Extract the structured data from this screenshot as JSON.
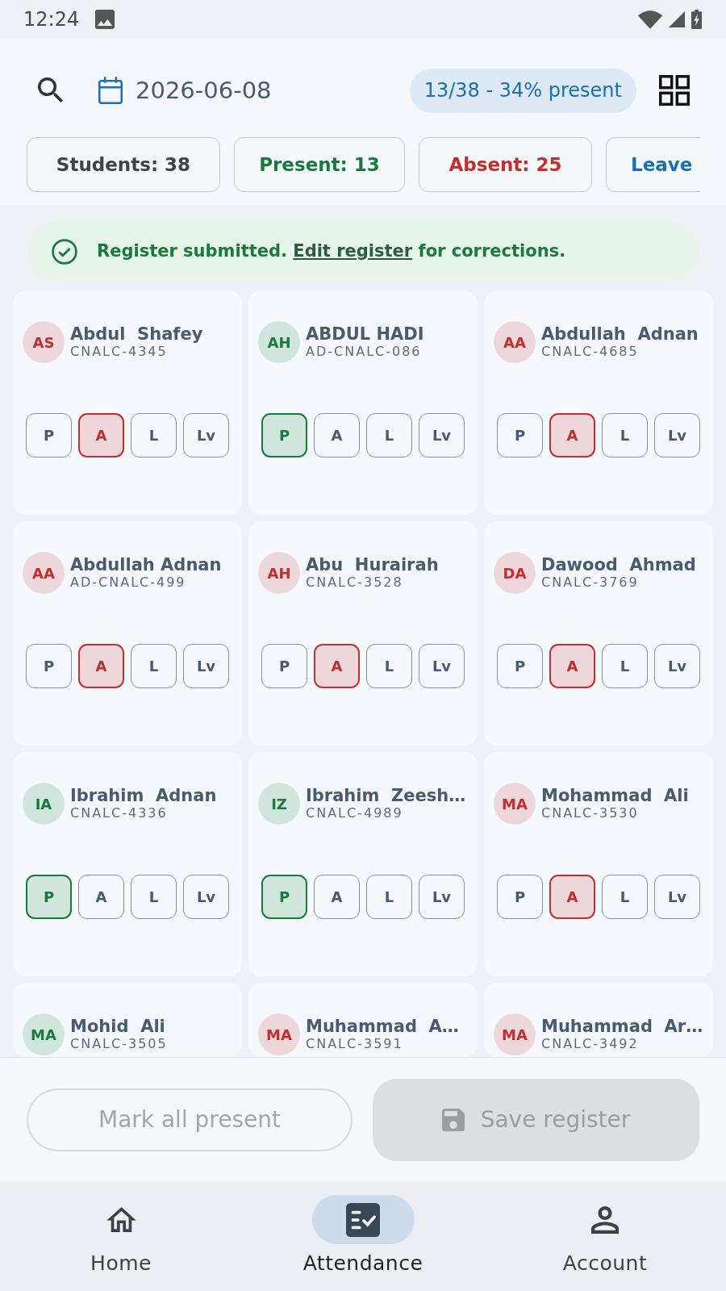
{
  "status_bar": {
    "time": "12:24"
  },
  "header": {
    "date": "2026-06-08",
    "summary": "13/38 - 34% present"
  },
  "stat_chips": [
    {
      "label": "Students: 38",
      "color": "#3f444c"
    },
    {
      "label": "Present: 13",
      "color": "#1a7a3e"
    },
    {
      "label": "Absent: 25",
      "color": "#c0302f"
    },
    {
      "label": "Leave",
      "color": "#1a6fb5"
    }
  ],
  "banner": {
    "text_before": "Register submitted.",
    "link": "Edit register",
    "text_after": "for corrections."
  },
  "students": [
    {
      "initials": "AS",
      "name": "Abdul  Shafey",
      "id": "CNALC-4345",
      "present": false,
      "marks": [
        {
          "label": "P",
          "selected": false
        },
        {
          "label": "A",
          "selected": true
        },
        {
          "label": "L",
          "selected": false
        },
        {
          "label": "Lv",
          "selected": false
        }
      ]
    },
    {
      "initials": "AH",
      "name": "ABDUL HADI",
      "id": "AD-CNALC-086",
      "present": true,
      "marks": [
        {
          "label": "P",
          "selected": true
        },
        {
          "label": "A",
          "selected": false
        },
        {
          "label": "L",
          "selected": false
        },
        {
          "label": "Lv",
          "selected": false
        }
      ]
    },
    {
      "initials": "AA",
      "name": "Abdullah  Adnan",
      "id": "CNALC-4685",
      "present": false,
      "marks": [
        {
          "label": "P",
          "selected": false
        },
        {
          "label": "A",
          "selected": true
        },
        {
          "label": "L",
          "selected": false
        },
        {
          "label": "Lv",
          "selected": false
        }
      ]
    },
    {
      "initials": "AA",
      "name": "Abdullah Adnan",
      "id": "AD-CNALC-499",
      "present": false,
      "marks": [
        {
          "label": "P",
          "selected": false
        },
        {
          "label": "A",
          "selected": true
        },
        {
          "label": "L",
          "selected": false
        },
        {
          "label": "Lv",
          "selected": false
        }
      ]
    },
    {
      "initials": "AH",
      "name": "Abu  Hurairah",
      "id": "CNALC-3528",
      "present": false,
      "marks": [
        {
          "label": "P",
          "selected": false
        },
        {
          "label": "A",
          "selected": true
        },
        {
          "label": "L",
          "selected": false
        },
        {
          "label": "Lv",
          "selected": false
        }
      ]
    },
    {
      "initials": "DA",
      "name": "Dawood  Ahmad",
      "id": "CNALC-3769",
      "present": false,
      "marks": [
        {
          "label": "P",
          "selected": false
        },
        {
          "label": "A",
          "selected": true
        },
        {
          "label": "L",
          "selected": false
        },
        {
          "label": "Lv",
          "selected": false
        }
      ]
    },
    {
      "initials": "IA",
      "name": "Ibrahim  Adnan",
      "id": "CNALC-4336",
      "present": true,
      "marks": [
        {
          "label": "P",
          "selected": true
        },
        {
          "label": "A",
          "selected": false
        },
        {
          "label": "L",
          "selected": false
        },
        {
          "label": "Lv",
          "selected": false
        }
      ]
    },
    {
      "initials": "IZ",
      "name": "Ibrahim  Zeesh…",
      "id": "CNALC-4989",
      "present": true,
      "marks": [
        {
          "label": "P",
          "selected": true
        },
        {
          "label": "A",
          "selected": false
        },
        {
          "label": "L",
          "selected": false
        },
        {
          "label": "Lv",
          "selected": false
        }
      ]
    },
    {
      "initials": "MA",
      "name": "Mohammad  Ali",
      "id": "CNALC-3530",
      "present": false,
      "marks": [
        {
          "label": "P",
          "selected": false
        },
        {
          "label": "A",
          "selected": true
        },
        {
          "label": "L",
          "selected": false
        },
        {
          "label": "Lv",
          "selected": false
        }
      ]
    },
    {
      "initials": "MA",
      "name": "Mohid  Ali",
      "id": "CNALC-3505",
      "present": true
    },
    {
      "initials": "MA",
      "name": "Muhammad  A…",
      "id": "CNALC-3591",
      "present": false
    },
    {
      "initials": "MA",
      "name": "Muhammad  Ar…",
      "id": "CNALC-3492",
      "present": false
    }
  ],
  "actions": [
    {
      "label": "Mark all present",
      "kind": "outlined",
      "disabled": true
    },
    {
      "label": "Save register",
      "kind": "filled",
      "disabled": true
    }
  ],
  "nav": [
    {
      "label": "Home",
      "selected": false
    },
    {
      "label": "Attendance",
      "selected": true
    },
    {
      "label": "Account",
      "selected": false
    }
  ]
}
